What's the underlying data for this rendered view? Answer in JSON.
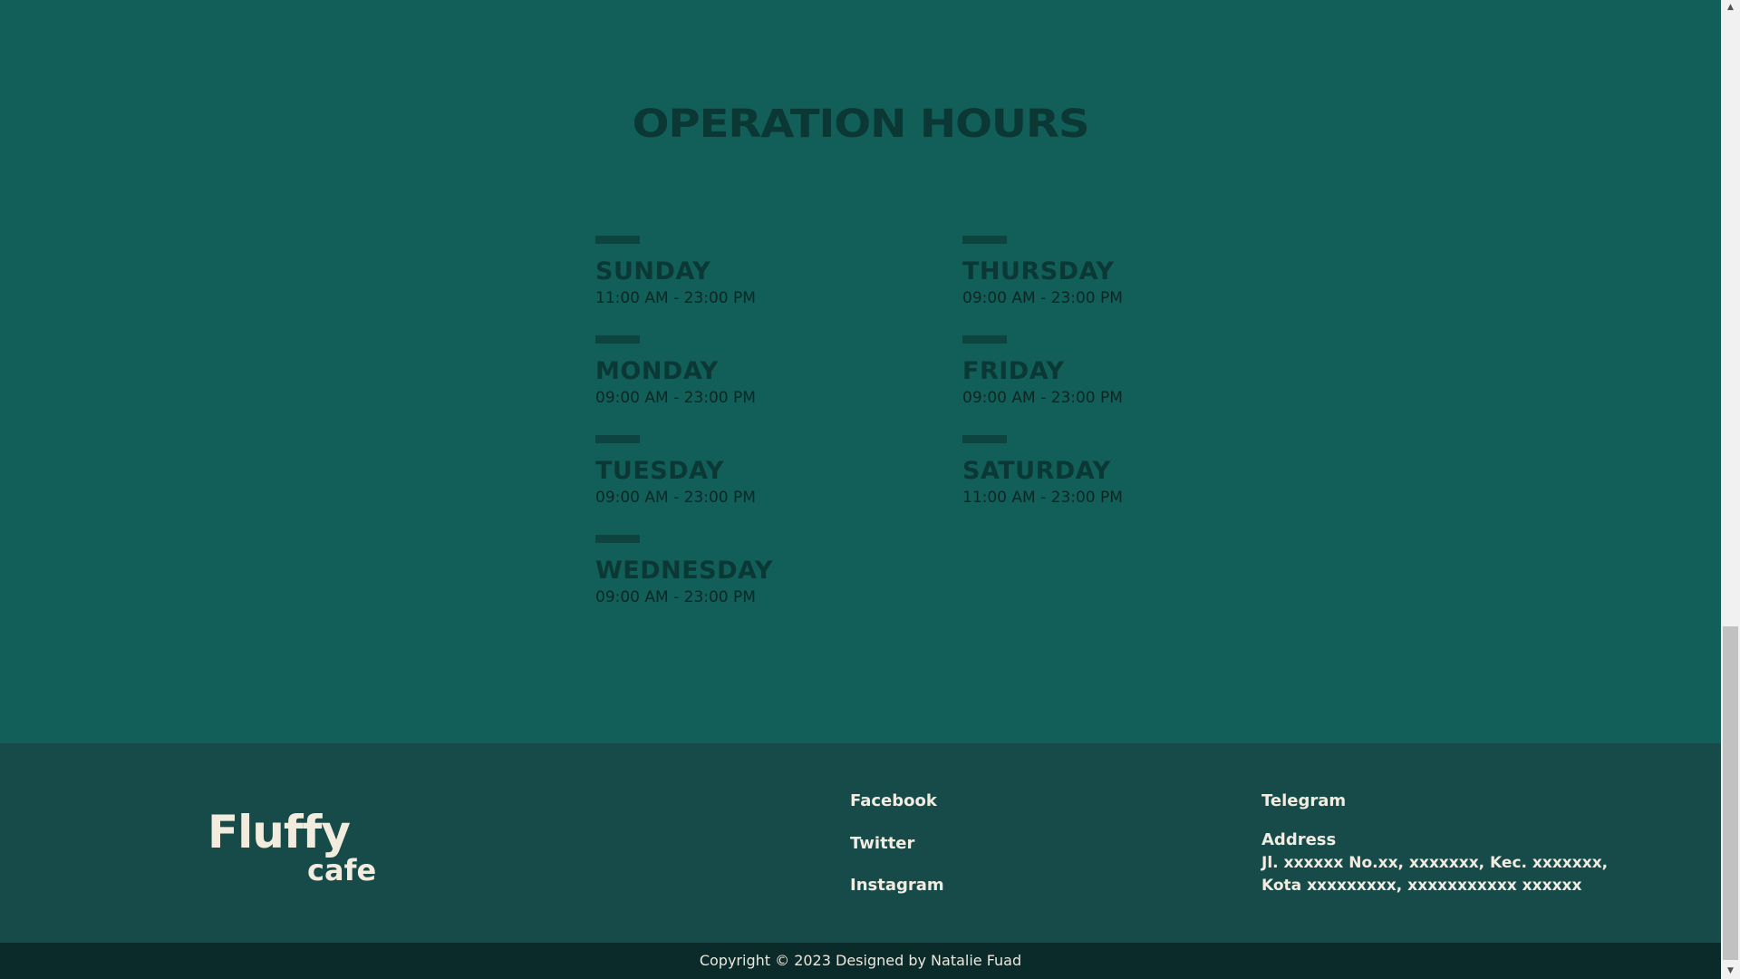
{
  "hours": {
    "title": "OPERATION HOURS",
    "days": [
      {
        "name": "SUNDAY",
        "time": "11:00 AM - 23:00 PM"
      },
      {
        "name": "MONDAY",
        "time": "09:00 AM - 23:00 PM"
      },
      {
        "name": "TUESDAY",
        "time": "09:00 AM - 23:00 PM"
      },
      {
        "name": "WEDNESDAY",
        "time": "09:00 AM - 23:00 PM"
      },
      {
        "name": "THURSDAY",
        "time": "09:00 AM - 23:00 PM"
      },
      {
        "name": "FRIDAY",
        "time": "09:00 AM - 23:00 PM"
      },
      {
        "name": "SATURDAY",
        "time": "11:00 AM - 23:00 PM"
      }
    ]
  },
  "footer": {
    "logo_main": "Fluffy",
    "logo_sub": "cafe",
    "social": {
      "facebook": "Facebook",
      "twitter": "Twitter",
      "instagram": "Instagram",
      "telegram": "Telegram"
    },
    "address_label": "Address",
    "address_line1": "Jl. xxxxxx No.xx, xxxxxxx, Kec. xxxxxxx,",
    "address_line2": "Kota xxxxxxxxx, xxxxxxxxxxx xxxxxx"
  },
  "copyright": "Copyright © 2023 Designed by Natalie Fuad",
  "colors": {
    "section_bg": "#125e58",
    "footer_bg": "#164b49",
    "copyright_bg": "#0a2b2a",
    "heading": "#0b3835",
    "light_text": "#f0ece2"
  },
  "icons": {
    "scroll_up": "▲",
    "scroll_down": "▼"
  }
}
